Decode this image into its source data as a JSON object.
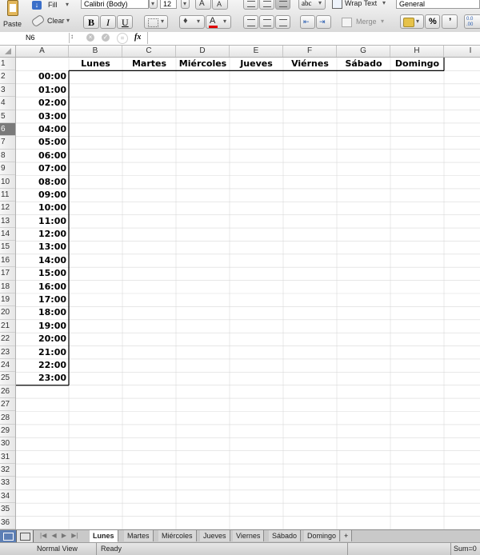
{
  "ribbon": {
    "fill_label": "Fill",
    "clear_label": "Clear",
    "paste_label": "Paste",
    "font_name": "Calibri (Body)",
    "font_size": "12",
    "bold_label": "B",
    "italic_label": "I",
    "underline_label": "U",
    "grow_font_label": "A",
    "shrink_font_label": "A",
    "font_color_label": "A",
    "abc_label": "abc",
    "wrap_text_label": "Wrap Text",
    "merge_label": "Merge",
    "number_format": "General",
    "percent_label": "%",
    "comma_label": "’",
    "increase_decimal_label": "0.0 .00",
    "fx_label": "fx"
  },
  "formula_bar": {
    "name_box": "N6",
    "value": ""
  },
  "columns": [
    "A",
    "B",
    "C",
    "D",
    "E",
    "F",
    "G",
    "H",
    "I"
  ],
  "rows": [
    "1",
    "2",
    "3",
    "4",
    "5",
    "6",
    "7",
    "8",
    "9",
    "10",
    "11",
    "12",
    "13",
    "14",
    "15",
    "16",
    "17",
    "18",
    "19",
    "20",
    "21",
    "22",
    "23",
    "24",
    "25",
    "26",
    "27",
    "28",
    "29",
    "30",
    "31",
    "32",
    "33",
    "34",
    "35",
    "36"
  ],
  "selected_row": "6",
  "header_days": [
    "Lunes",
    "Martes",
    "Miércoles",
    "Jueves",
    "Viérnes",
    "Sábado",
    "Domingo"
  ],
  "hours": [
    "00:00",
    "01:00",
    "02:00",
    "03:00",
    "04:00",
    "05:00",
    "06:00",
    "07:00",
    "08:00",
    "09:00",
    "10:00",
    "11:00",
    "12:00",
    "13:00",
    "14:00",
    "15:00",
    "16:00",
    "17:00",
    "18:00",
    "19:00",
    "20:00",
    "21:00",
    "22:00",
    "23:00"
  ],
  "sheet_tabs": [
    "Lunes",
    "Martes",
    "Miércoles",
    "Jueves",
    "Viernes",
    "Sábado",
    "Domingo",
    "+"
  ],
  "active_tab": "Lunes",
  "status": {
    "view": "Normal View",
    "state": "Ready",
    "sum": "Sum=0"
  },
  "colors": {
    "grid_line": "#d9d9d9",
    "border_dark": "#000000",
    "selected_row_header": "#7a7a7a",
    "font_color_underline": "#e00000"
  }
}
